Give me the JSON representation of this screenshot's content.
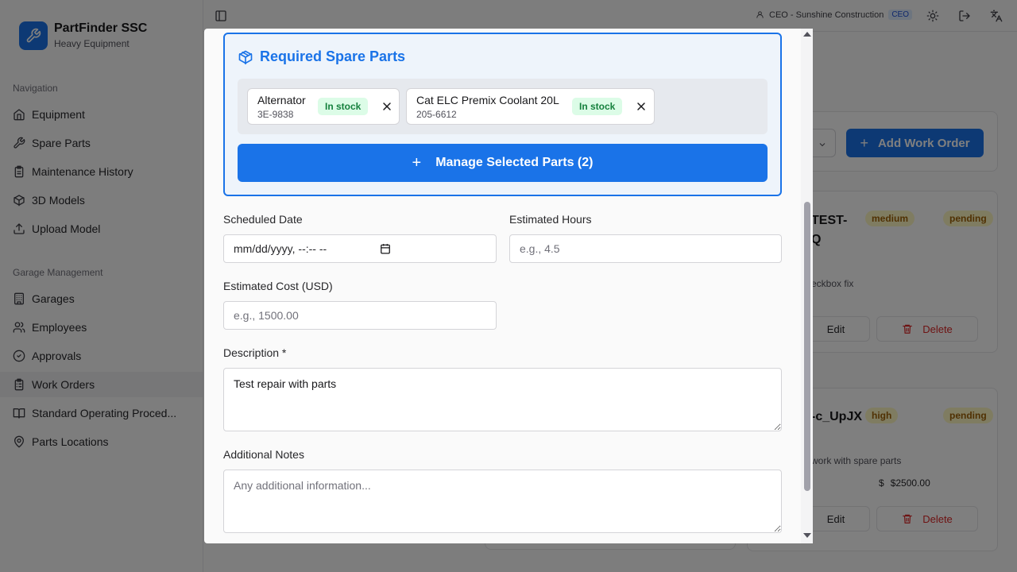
{
  "brand": {
    "title": "PartFinder SSC",
    "subtitle": "Heavy Equipment"
  },
  "sidebar": {
    "sections": [
      {
        "label": "Navigation",
        "items": [
          {
            "label": "Equipment",
            "icon": "home-icon"
          },
          {
            "label": "Spare Parts",
            "icon": "wrench-icon"
          },
          {
            "label": "Maintenance History",
            "icon": "clipboard-icon"
          },
          {
            "label": "3D Models",
            "icon": "cube-icon"
          },
          {
            "label": "Upload Model",
            "icon": "upload-icon"
          }
        ]
      },
      {
        "label": "Garage Management",
        "items": [
          {
            "label": "Garages",
            "icon": "building-icon"
          },
          {
            "label": "Employees",
            "icon": "users-icon"
          },
          {
            "label": "Approvals",
            "icon": "check-circle-icon"
          },
          {
            "label": "Work Orders",
            "icon": "clipboard-list-icon",
            "active": true
          },
          {
            "label": "Standard Operating Proced...",
            "icon": "book-icon"
          },
          {
            "label": "Parts Locations",
            "icon": "map-pin-icon"
          }
        ]
      }
    ]
  },
  "header": {
    "user": "CEO - Sunshine Construction",
    "role": "CEO"
  },
  "background": {
    "add_work_order": "Add Work Order",
    "cards": [
      {
        "title": "TEST-",
        "title2": "Q",
        "priority": "medium",
        "status": "pending",
        "desc": "eckbox fix",
        "edit": "Edit",
        "delete": "Delete"
      },
      {
        "title": "-c_UpJX",
        "priority": "high",
        "status": "pending",
        "desc": "work with spare parts",
        "cost": "$2500.00",
        "edit": "Edit",
        "delete": "Delete"
      }
    ]
  },
  "modal": {
    "parts_title": "Required Spare Parts",
    "parts": [
      {
        "name": "Alternator",
        "number": "3E-9838",
        "stock": "In stock"
      },
      {
        "name": "Cat ELC Premix Coolant 20L",
        "number": "205-6612",
        "stock": "In stock"
      }
    ],
    "manage_button": "Manage Selected Parts (2)",
    "scheduled_date": {
      "label": "Scheduled Date",
      "value": "mm/dd/yyyy, --:-- --"
    },
    "estimated_hours": {
      "label": "Estimated Hours",
      "placeholder": "e.g., 4.5"
    },
    "estimated_cost": {
      "label": "Estimated Cost (USD)",
      "placeholder": "e.g., 1500.00"
    },
    "description": {
      "label": "Description *",
      "value": "Test repair with parts"
    },
    "notes": {
      "label": "Additional Notes",
      "placeholder": "Any additional information..."
    }
  },
  "colors": {
    "primary": "#1a73e8",
    "stock_bg": "#dcfce7",
    "stock_text": "#15803d"
  }
}
